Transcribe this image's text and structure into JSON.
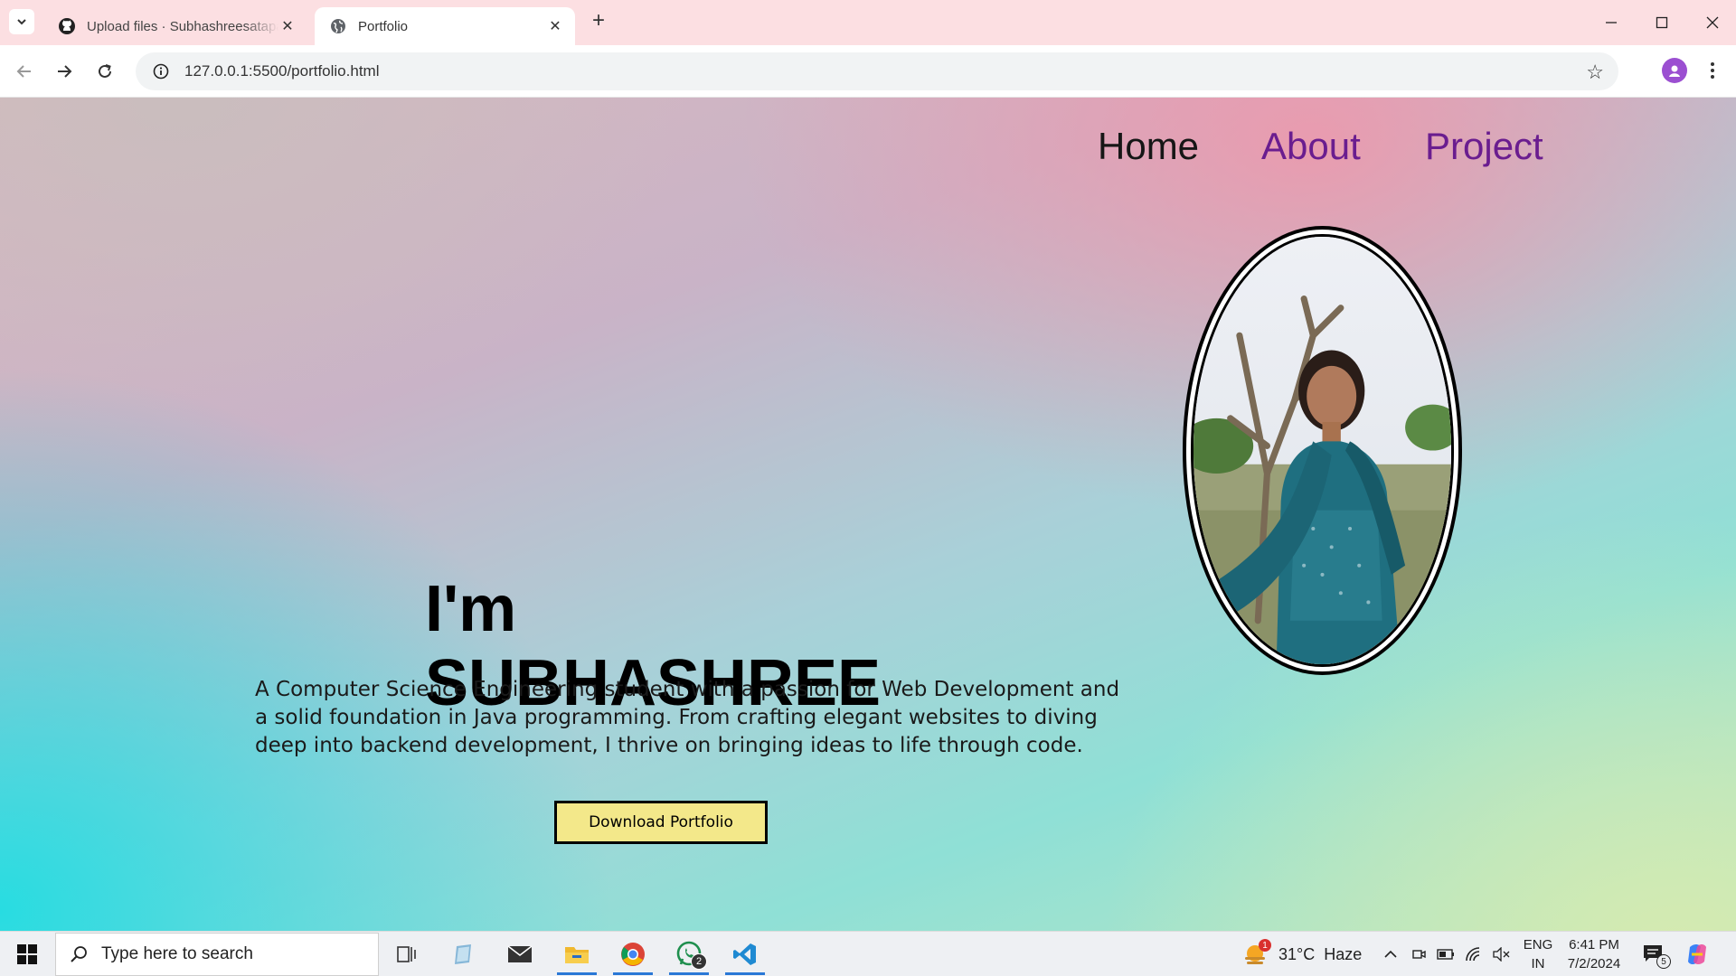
{
  "browser": {
    "tabs": [
      {
        "title": "Upload files · Subhashreesatapathy",
        "icon": "github-icon",
        "active": false
      },
      {
        "title": "Portfolio",
        "icon": "globe-icon",
        "active": true
      }
    ],
    "url": "127.0.0.1:5500/portfolio.html"
  },
  "page": {
    "nav": {
      "home": "Home",
      "about": "About",
      "project": "Project"
    },
    "heading": "I'm SUBHASHREE",
    "bio": "A Computer Science Engineering student with a passion for Web Development and a solid foundation in Java programming. From crafting elegant websites to diving deep into backend development, I thrive on bringing ideas to life through code.",
    "button": "Download Portfolio",
    "colors": {
      "nav_active": "#161616",
      "nav_link": "#6a1d8f",
      "button_bg": "#f3e88a"
    }
  },
  "taskbar": {
    "search_placeholder": "Type here to search",
    "weather": {
      "temp": "31°C",
      "condition": "Haze",
      "alert_count": "1"
    },
    "apps": [
      {
        "name": "task-view-icon"
      },
      {
        "name": "notepad-icon"
      },
      {
        "name": "mail-icon"
      },
      {
        "name": "file-explorer-icon"
      },
      {
        "name": "chrome-icon"
      },
      {
        "name": "whatsapp-icon",
        "badge": "2"
      },
      {
        "name": "vscode-icon"
      }
    ],
    "language": {
      "line1": "ENG",
      "line2": "IN"
    },
    "time": "6:41 PM",
    "date": "7/2/2024",
    "notifications": "5"
  }
}
